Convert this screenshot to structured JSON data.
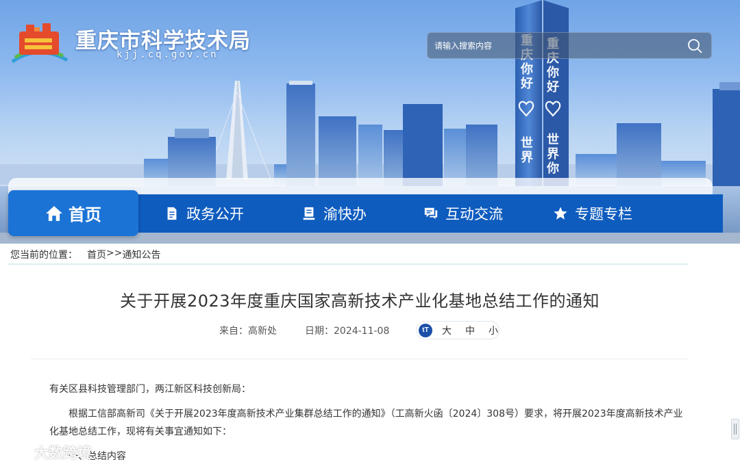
{
  "header": {
    "site_title": "重庆市科学技术局",
    "site_domain": "kjj.cq.gov.cn",
    "logo_icon": "cq-kjj-logo-icon",
    "search": {
      "placeholder": "请输入搜索内容",
      "button_icon": "search-icon"
    }
  },
  "banner": {
    "tower_text_left": "重庆你好世界",
    "tower_text_right": "重庆你好世界你好"
  },
  "nav": {
    "items": [
      {
        "label": "首页",
        "icon": "home-icon",
        "active": true
      },
      {
        "label": "政务公开",
        "icon": "document-icon",
        "active": false
      },
      {
        "label": "渝快办",
        "icon": "book-stand-icon",
        "active": false
      },
      {
        "label": "互动交流",
        "icon": "chat-icon",
        "active": false
      },
      {
        "label": "专题专栏",
        "icon": "star-icon",
        "active": false
      }
    ]
  },
  "breadcrumb": {
    "label": "您当前的位置：",
    "items": [
      "首页",
      ">>",
      "通知公告"
    ]
  },
  "article": {
    "title": "关于开展2023年度重庆国家高新技术产业化基地总结工作的通知",
    "source_label": "来自：",
    "source": "高新处",
    "date_label": "日期：",
    "date": "2024-11-08",
    "font_size_icon": "font-size-icon",
    "font_size_icon_text": "tT",
    "font_sizes": [
      "大",
      "中",
      "小"
    ],
    "salutation": "有关区县科技管理部门，两江新区科技创新局：",
    "para1_line1": "根据工信部高新司《关于开展2023年度高新技术产业集群总结工作的通知》（工高新火函〔2024〕308号）要求，将开展2023年度高新技术产业",
    "para1_line2": "化基地总结工作，现将有关事宜通知如下：",
    "section1": "一、总结内容"
  },
  "watermark": {
    "text": "大数跨境"
  },
  "colors": {
    "nav_bg": "#0f5cbf",
    "nav_active": "#1b73d6",
    "title_text": "#333333"
  }
}
